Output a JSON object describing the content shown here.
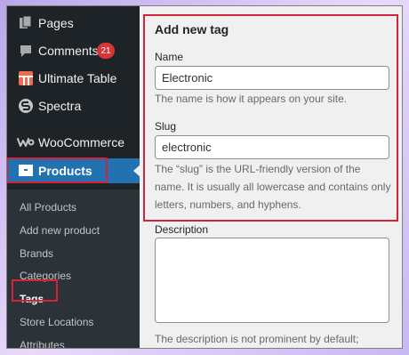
{
  "sidebar": {
    "items": [
      {
        "label": "Pages",
        "icon": "pages-icon"
      },
      {
        "label": "Comments",
        "icon": "comments-icon",
        "badge": "21"
      },
      {
        "label": "Ultimate Table",
        "icon": "table-icon"
      },
      {
        "label": "Spectra",
        "icon": "spectra-icon"
      },
      {
        "label": "WooCommerce",
        "icon": "woocommerce-icon"
      },
      {
        "label": "Products",
        "icon": "products-icon",
        "active": true
      }
    ],
    "submenu": [
      {
        "label": "All Products"
      },
      {
        "label": "Add new product"
      },
      {
        "label": "Brands"
      },
      {
        "label": "Categories"
      },
      {
        "label": "Tags",
        "current": true
      },
      {
        "label": "Store Locations"
      },
      {
        "label": "Attributes"
      }
    ]
  },
  "form": {
    "title": "Add new tag",
    "name": {
      "label": "Name",
      "value": "Electronic",
      "help": "The name is how it appears on your site."
    },
    "slug": {
      "label": "Slug",
      "value": "electronic",
      "help": "The “slug” is the URL-friendly version of the name. It is usually all lowercase and contains only letters, numbers, and hyphens."
    },
    "description": {
      "label": "Description",
      "value": "",
      "help": "The description is not prominent by default;"
    }
  },
  "colors": {
    "sidebar_bg": "#1d2327",
    "submenu_bg": "#2c3338",
    "active_bg": "#2271b1",
    "highlight_border": "#d3233c",
    "badge_bg": "#d63638"
  }
}
